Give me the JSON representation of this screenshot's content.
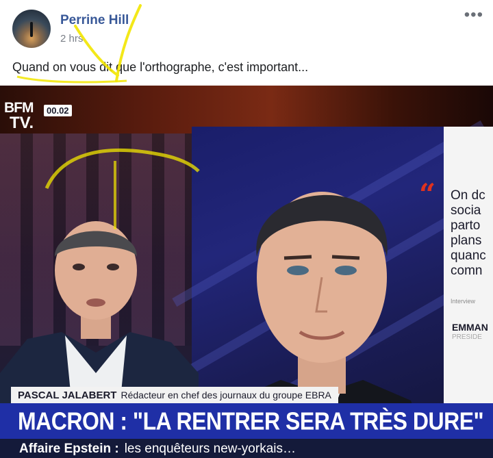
{
  "post": {
    "author": "Perrine Hill",
    "time": "2 hrs",
    "caption": "Quand on vous dit que l'orthographe, c'est important...",
    "more_icon": "ellipsis-icon"
  },
  "broadcast": {
    "channel_logo_top": "BFM",
    "channel_logo_bottom": "TV.",
    "clock": "00.02",
    "quote_lines": [
      "On dc",
      "socia",
      "parto",
      "plans",
      "quanc",
      "comn"
    ],
    "interview_label": "Interview",
    "signature_name": "EMMAN",
    "signature_title": "PRESIDE",
    "guest_name": "PASCAL JALABERT",
    "guest_role": "Rédacteur en chef des journaux du groupe EBRA",
    "headline": "MACRON : \"LA RENTRER SERA TRÈS DURE\"",
    "ticker_label": "Affaire Epstein :",
    "ticker_text": "les enquêteurs new-yorkais…"
  },
  "colors": {
    "author_link": "#385898",
    "headline_bar": "#1f2fa6",
    "quote_mark": "#e0321e",
    "highlighter": "#f2e600"
  }
}
